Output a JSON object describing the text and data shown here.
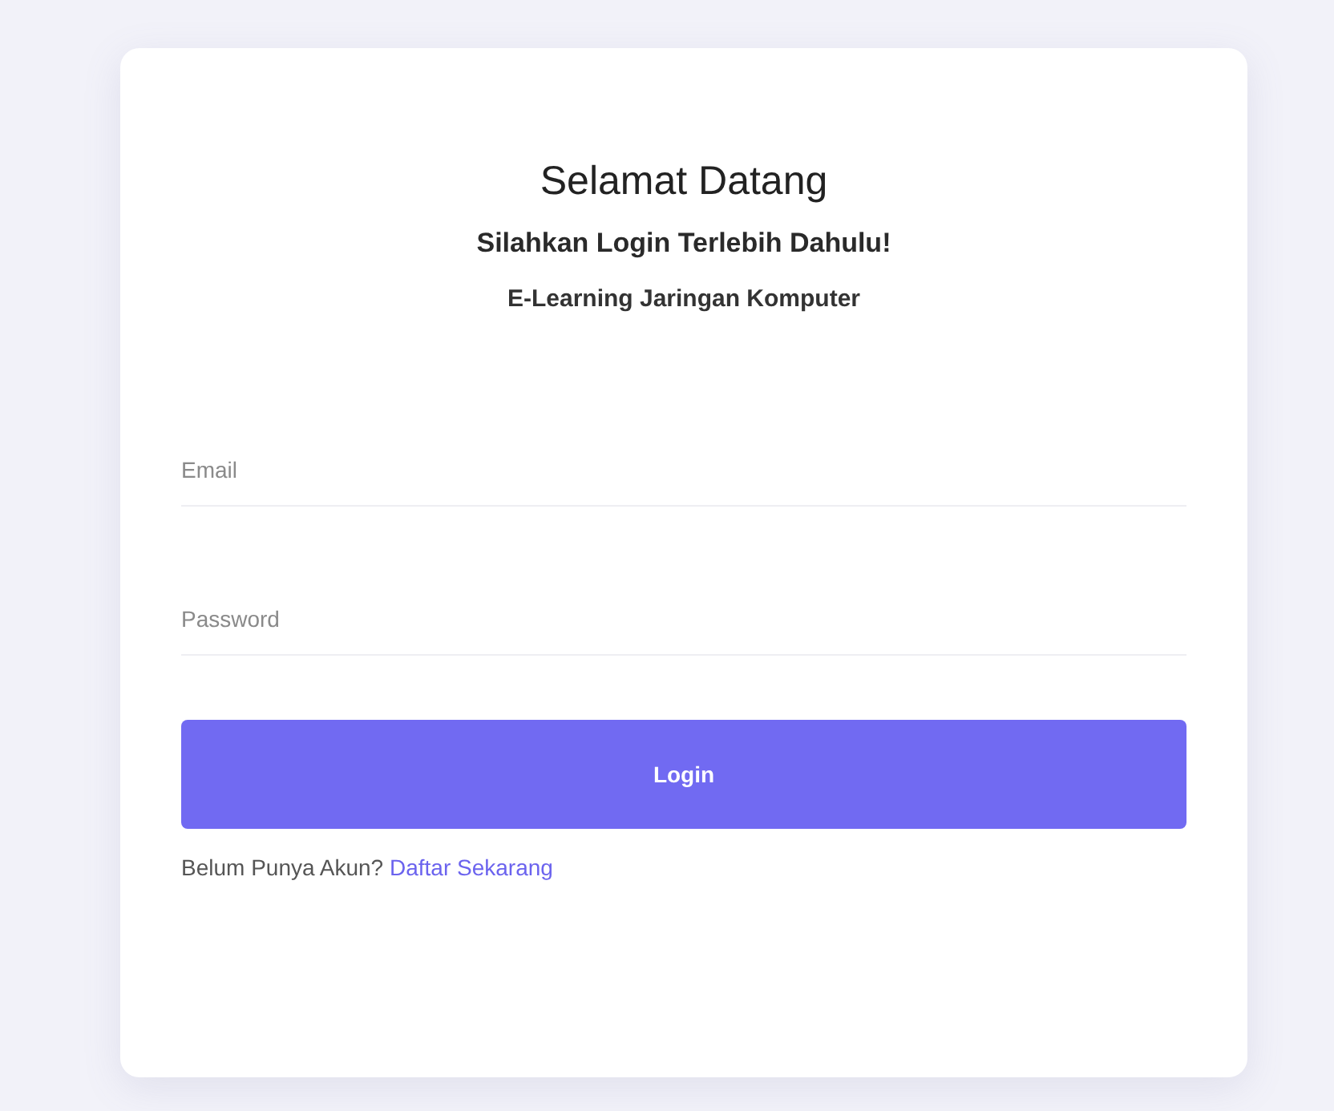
{
  "title": "Selamat Datang",
  "subtitle": "Silahkan Login Terlebih Dahulu!",
  "app_name": "E-Learning Jaringan Komputer",
  "fields": [
    {
      "placeholder": "Email"
    },
    {
      "placeholder": "Password"
    }
  ],
  "login_button": "Login",
  "register_prompt": {
    "text": "Belum Punya Akun?",
    "link": "Daftar Sekarang"
  }
}
